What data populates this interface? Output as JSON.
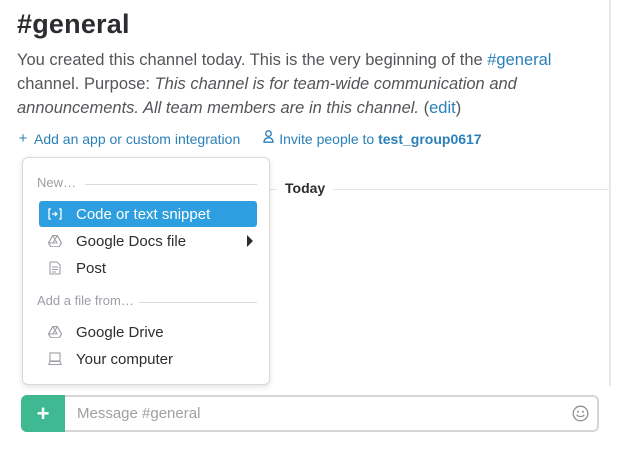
{
  "channel": {
    "title": "#general",
    "intro_prefix": "You created this channel today. This is the very beginning of the ",
    "intro_channel_link": "#general",
    "intro_middle": " channel. Purpose: ",
    "purpose": "This channel is for team-wide communication and announcements. All team members are in this channel.",
    "edit_open": " (",
    "edit_link": "edit",
    "edit_close": ")"
  },
  "actions": {
    "add_app_icon": "plus-icon",
    "add_app_label": "Add an app or custom integration",
    "invite_icon": "person-icon",
    "invite_label_prefix": "Invite people to ",
    "invite_team": "test_group0617"
  },
  "divider": {
    "label": "Today"
  },
  "upload_menu": {
    "new_heading": "New…",
    "new_items": [
      {
        "label": "Code or text snippet",
        "icon": "snippet-icon",
        "active": true
      },
      {
        "label": "Google Docs file",
        "icon": "google-drive-icon",
        "has_submenu": true
      },
      {
        "label": "Post",
        "icon": "document-icon"
      }
    ],
    "from_heading": "Add a file from…",
    "from_items": [
      {
        "label": "Google Drive",
        "icon": "google-drive-icon"
      },
      {
        "label": "Your computer",
        "icon": "computer-icon"
      }
    ]
  },
  "composer": {
    "plus_label": "+",
    "placeholder": "Message #general",
    "value": "",
    "emoji_icon": "smiley-icon"
  },
  "colors": {
    "link": "#2a80b9",
    "menu_active": "#2d9ee0",
    "plus_button": "#3eb991",
    "text": "#2c2d30",
    "muted": "#9e9ea6"
  }
}
